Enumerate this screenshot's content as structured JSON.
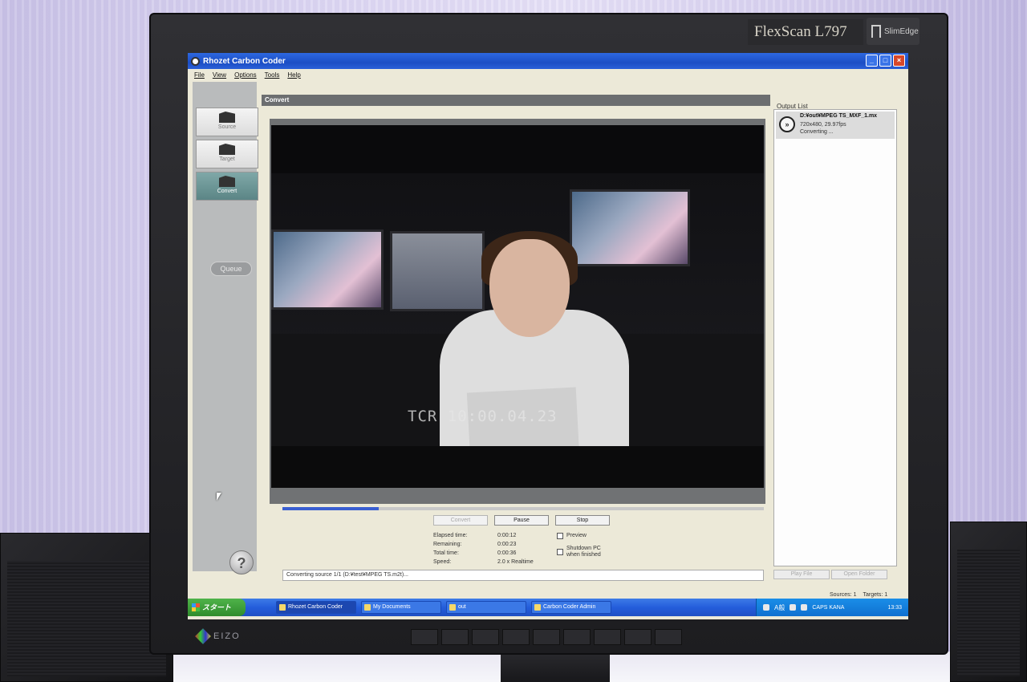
{
  "monitor": {
    "brand": "FlexScan L797",
    "badge": "SlimEdge",
    "maker": "EIZO"
  },
  "window": {
    "title": "Rhozet Carbon Coder",
    "controls": [
      "_",
      "□",
      "×"
    ]
  },
  "menu": [
    "File",
    "View",
    "Options",
    "Tools",
    "Help"
  ],
  "nav": {
    "items": [
      {
        "label": "Source"
      },
      {
        "label": "Target"
      },
      {
        "label": "Convert"
      }
    ],
    "queue_label": "Queue",
    "help_label": "?"
  },
  "convert": {
    "header": "Convert",
    "timecode": "TCR 10:00.04.23",
    "progress": 0.2,
    "buttons": {
      "convert": "Convert",
      "pause": "Pause",
      "stop": "Stop"
    },
    "stats": [
      {
        "label": "Elapsed time:",
        "value": "0:00:12"
      },
      {
        "label": "Remaining:",
        "value": "0:00:23"
      },
      {
        "label": "Total time:",
        "value": "0:00:36"
      },
      {
        "label": "Speed:",
        "value": "2.0 x Realtime"
      }
    ],
    "options": {
      "preview": "Preview",
      "shutdown": "Shutdown PC when finished"
    },
    "status": "Converting source 1/1 (D:¥test¥MPEG TS.m2t)..."
  },
  "output": {
    "label": "Output List",
    "items": [
      {
        "name": "D:¥out¥MPEG TS_MXF_1.mx",
        "meta": "720x480, 29.97fps",
        "status": "Converting ..."
      }
    ],
    "play_file": "Play File",
    "open_folder": "Open Folder"
  },
  "counts": {
    "sources": "Sources: 1",
    "targets": "Targets: 1"
  },
  "taskbar": {
    "start": "スタート",
    "items": [
      {
        "label": "Rhozet Carbon Coder"
      },
      {
        "label": "My Documents"
      },
      {
        "label": "out"
      },
      {
        "label": "Carbon Coder Admin"
      }
    ],
    "tray": {
      "ime": "A般",
      "caps": "CAPS KANA",
      "clock": "13:33"
    }
  }
}
